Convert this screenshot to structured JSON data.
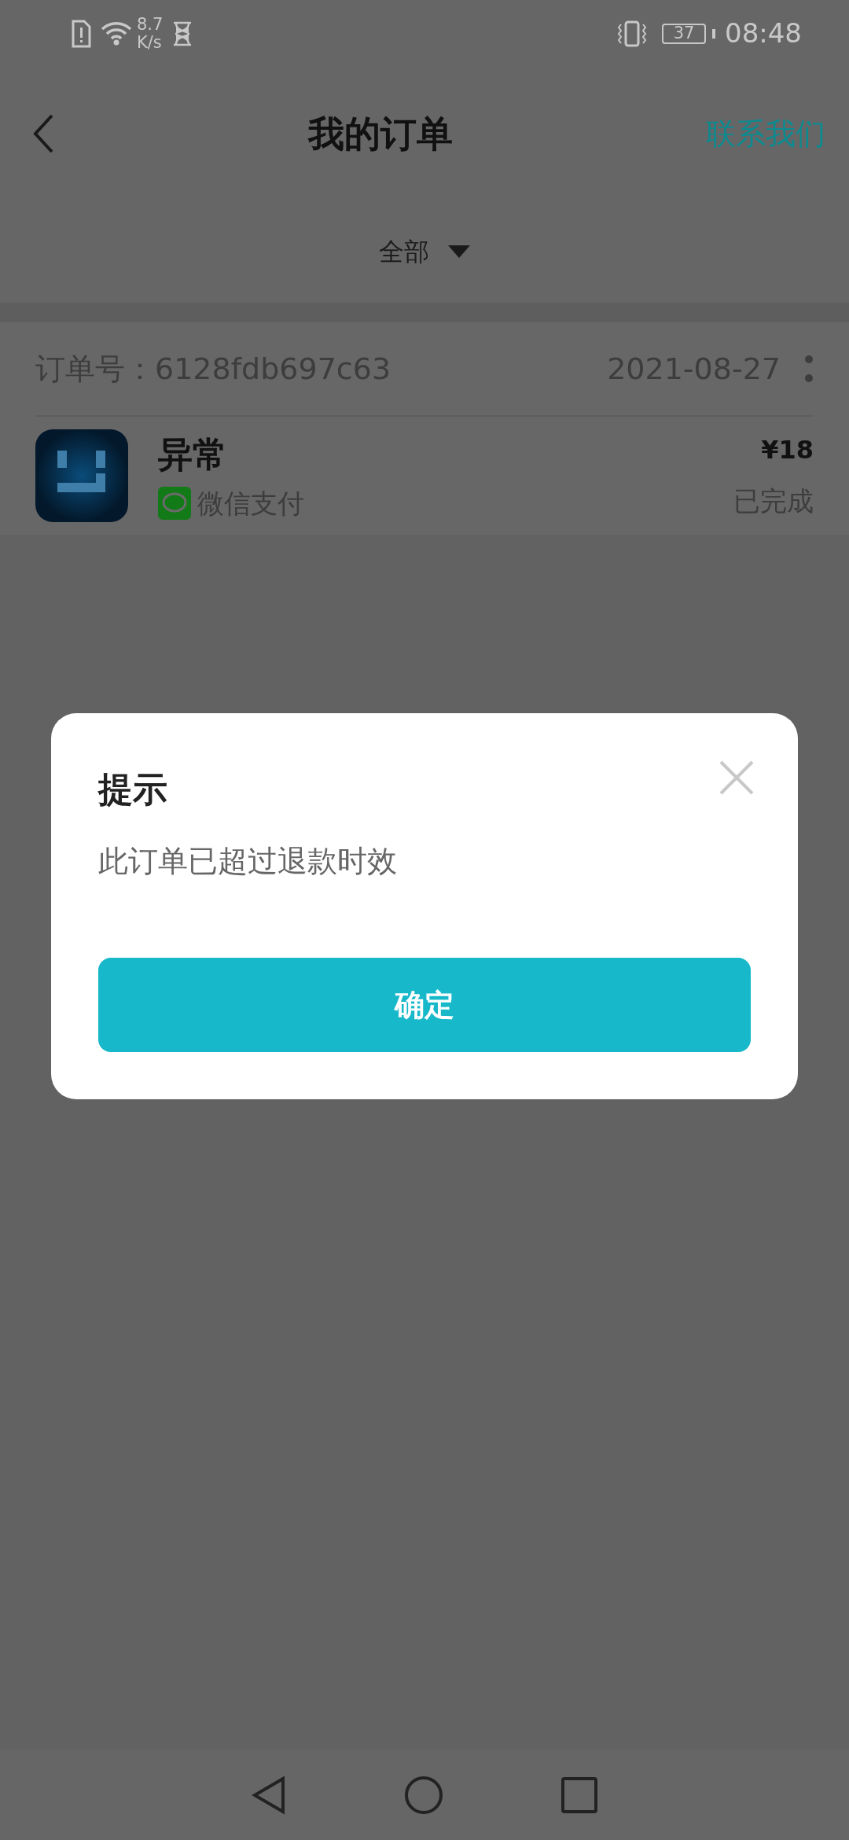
{
  "status_bar": {
    "network_speed": "8.7",
    "network_speed_unit": "K/s",
    "battery": "37",
    "time": "08:48"
  },
  "header": {
    "title": "我的订单",
    "action": "联系我们"
  },
  "filter": {
    "label": "全部"
  },
  "orders": [
    {
      "order_no": "订单号：6128fdb697c63",
      "date": "2021-08-27",
      "name": "异常",
      "payment": "微信支付",
      "price": "¥18",
      "status": "已完成"
    }
  ],
  "dialog": {
    "title": "提示",
    "message": "此订单已超过退款时效",
    "button": "确定"
  }
}
